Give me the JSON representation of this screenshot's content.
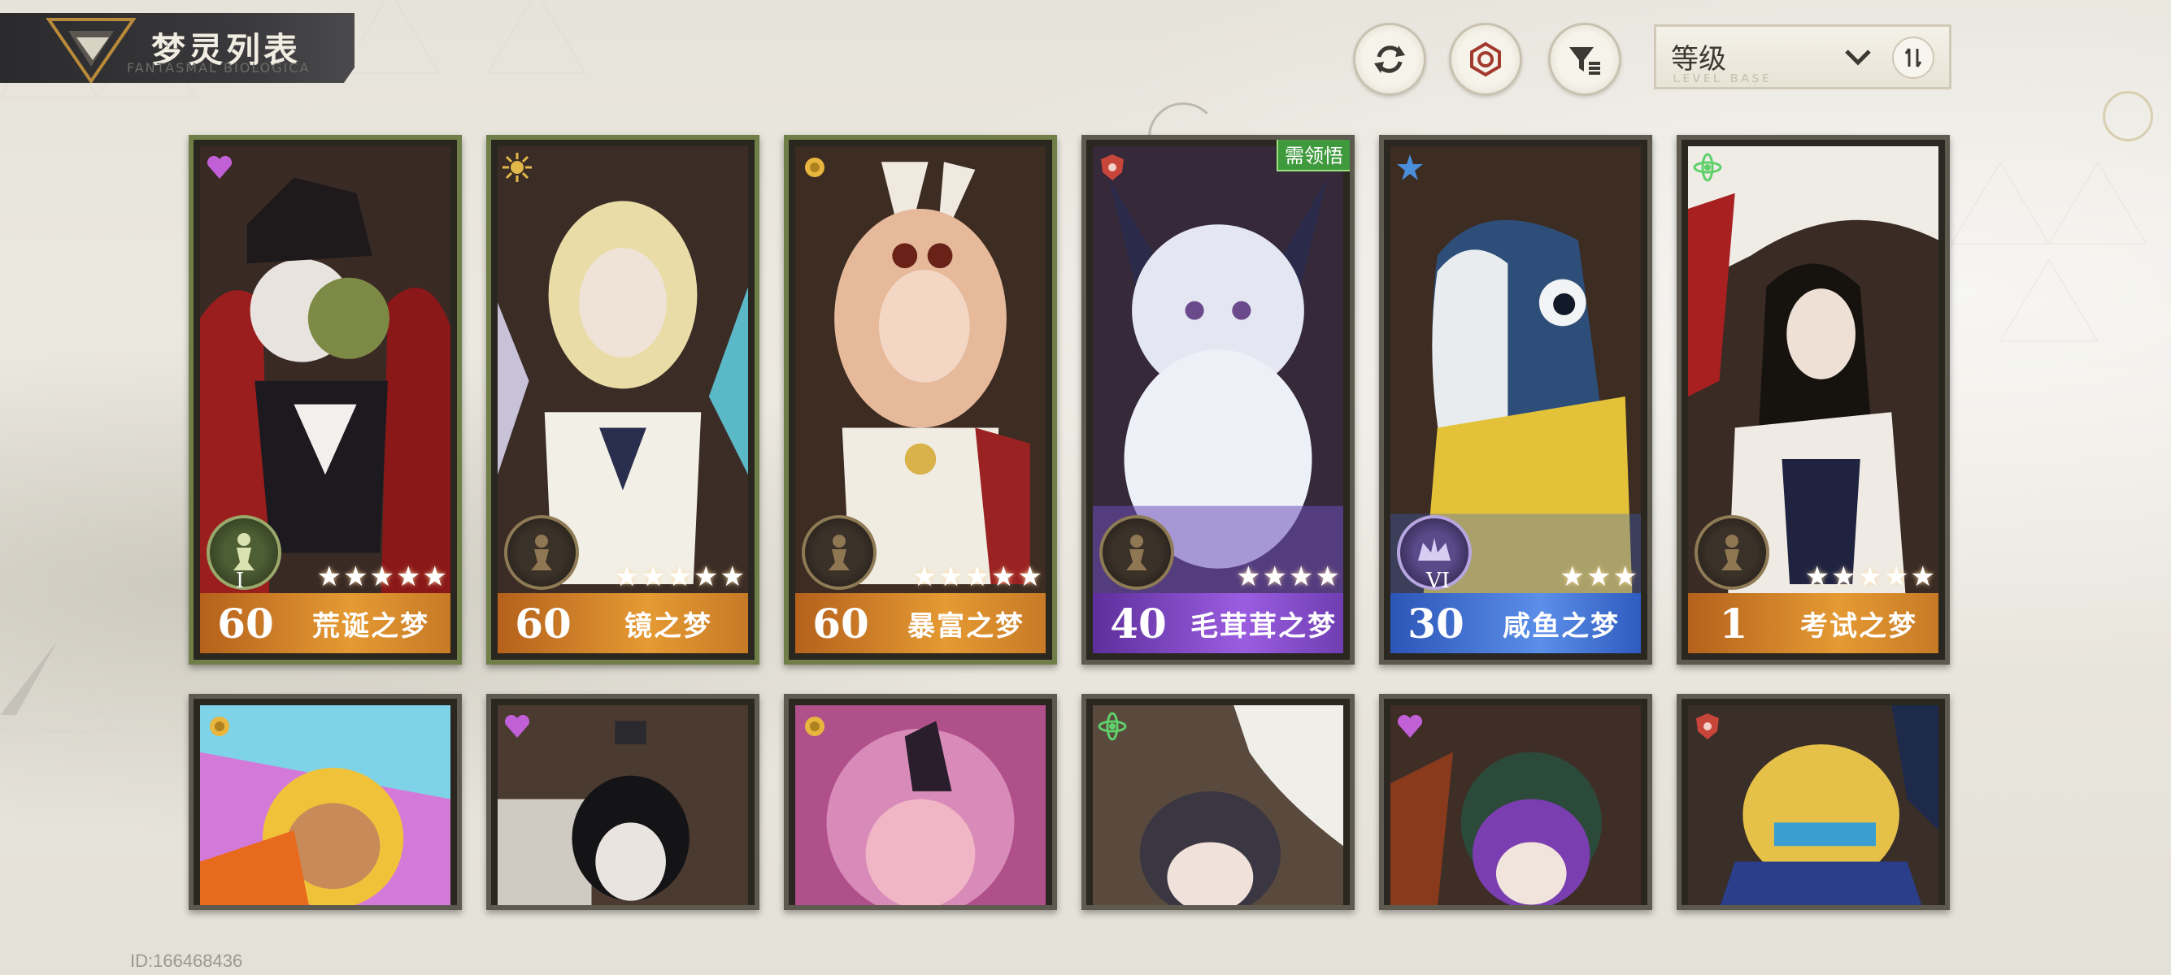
{
  "header": {
    "title": "梦灵列表",
    "subtitle": "FANTASMAL BIOLOGICA"
  },
  "toolbar": {
    "refresh_icon": "refresh-icon",
    "target_icon": "target-icon",
    "filter_icon": "filter-icon",
    "sort_label": "等级",
    "sort_ghost": "ʟᴇᴠᴇʟ ʙᴀꜱᴇ",
    "order_icon": "sort-order-icon"
  },
  "cards_row1": [
    {
      "level": "60",
      "name": "荒诞之梦",
      "stars": "★★★★★",
      "rank_numeral": "I",
      "element": "heart",
      "selected": true
    },
    {
      "level": "60",
      "name": "镜之梦",
      "stars": "★★★★★",
      "rank_numeral": "",
      "element": "sun",
      "selected": true
    },
    {
      "level": "60",
      "name": "暴富之梦",
      "stars": "★★★★★",
      "rank_numeral": "",
      "element": "coin",
      "selected": true
    },
    {
      "level": "40",
      "name": "毛茸茸之梦",
      "stars": "★★★★",
      "rank_numeral": "",
      "element": "shield",
      "badge": "需领悟",
      "selected": false
    },
    {
      "level": "30",
      "name": "咸鱼之梦",
      "stars": "★★★",
      "rank_numeral": "VI",
      "element": "star",
      "selected": false
    },
    {
      "level": "1",
      "name": "考试之梦",
      "stars": "★★★★★",
      "rank_numeral": "",
      "element": "atom",
      "selected": false
    }
  ],
  "footer": {
    "user_id": "ID:166468436"
  },
  "colors": {
    "gold_bar": "#e59a33",
    "purple_bar": "#9b5de0",
    "blue_bar": "#5b8fe8",
    "selected_border": "#6f7f47"
  }
}
